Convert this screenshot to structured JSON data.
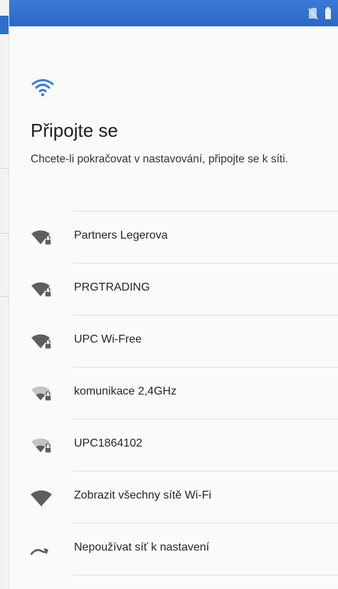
{
  "colors": {
    "accent": "#3a7ad6",
    "wifi_strong": "#5e5e5e",
    "wifi_weak": "#b3b3b3"
  },
  "status_bar": {
    "icons": [
      "no-sim-icon",
      "battery-icon"
    ]
  },
  "header": {
    "icon": "wifi-icon",
    "title": "Připojte se",
    "subtitle": "Chcete-li pokračovat v nastavování, připojte se k síti."
  },
  "networks": [
    {
      "name": "Partners Legerova",
      "icon": "wifi-lock-icon",
      "signal": 3
    },
    {
      "name": "PRGTRADING",
      "icon": "wifi-lock-icon",
      "signal": 3
    },
    {
      "name": "UPC Wi-Free",
      "icon": "wifi-lock-icon",
      "signal": 3
    },
    {
      "name": "komunikace 2,4GHz",
      "icon": "wifi-lock-icon",
      "signal": 1
    },
    {
      "name": "UPC1864102",
      "icon": "wifi-lock-icon",
      "signal": 1
    }
  ],
  "actions": {
    "show_all": {
      "label": "Zobrazit všechny sítě Wi-Fi",
      "icon": "wifi-icon"
    },
    "skip": {
      "label": "Nepoužívat síť k nastavení",
      "icon": "skip-arrow-icon"
    }
  }
}
